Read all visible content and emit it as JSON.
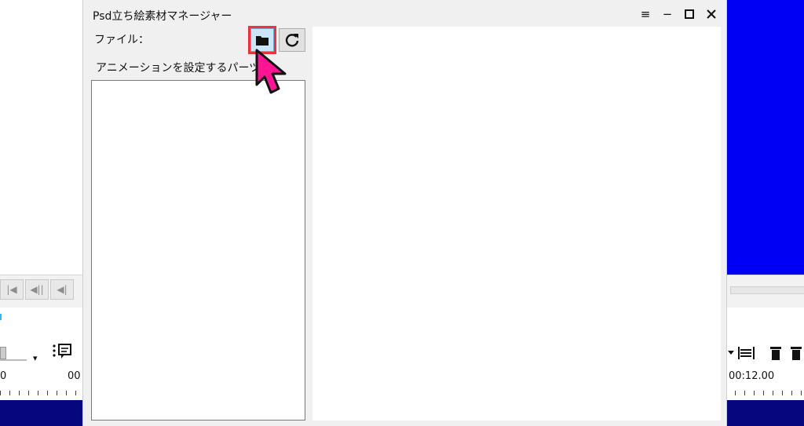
{
  "dialog": {
    "title": "Psd立ち絵素材マネージャー",
    "controls": {
      "menu_glyph": "≡",
      "minimize_glyph": "−",
      "maximize_glyph": "□",
      "close_glyph": "✕"
    },
    "file_label": "ファイル：",
    "open_button_icon": "folder-icon",
    "reload_button_icon": "reload-icon",
    "parts_label": "アニメーションを設定するパーツ",
    "parts_list_items": []
  },
  "background_app": {
    "transport_buttons": [
      "|◀",
      "◀||",
      "◀|"
    ],
    "time_left_a": "0",
    "time_left_b": "00",
    "time_right": "00:12.00"
  },
  "colors": {
    "highlight_box": "#e8343a",
    "cursor_fill": "#ff1493",
    "open_button_bg": "#cde6f7",
    "bg_blue": "#0000f5",
    "bg_dark_blue": "#06067e"
  }
}
